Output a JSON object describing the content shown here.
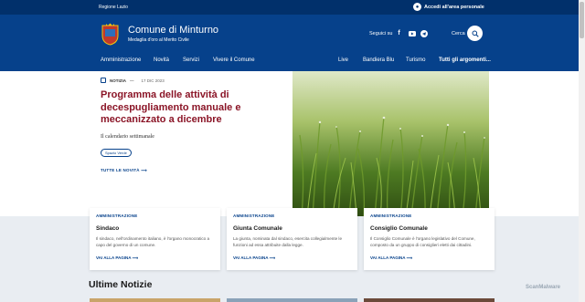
{
  "topbar": {
    "region": "Regione Lazio",
    "access": "Accedi all'area personale"
  },
  "brand": {
    "title": "Comune di Minturno",
    "subtitle": "Medaglia d'oro al Merito Civile"
  },
  "header": {
    "social_label": "Seguici su",
    "search_label": "Cerca"
  },
  "nav": {
    "left": [
      "Amministrazione",
      "Novità",
      "Servizi",
      "Vivere il Comune"
    ],
    "right": [
      "Live",
      "Bandiera Blu",
      "Turismo",
      "Tutti gli argomenti..."
    ]
  },
  "hero": {
    "category": "NOTIZIA",
    "date": "17 DIC 2023",
    "title": "Programma delle attività di decespugliamento manuale e meccanizzato a dicembre",
    "description": "Il calendario settimanale",
    "tag": "Spazio Verde",
    "all_news": "TUTTE LE NOVITÀ"
  },
  "cards": [
    {
      "category": "AMMINISTRAZIONE",
      "title": "Sindaco",
      "desc": "Il sindaco, nell'ordinamento italiano, è l'organo monocratico a capo del governo di un comune.",
      "link": "VAI ALLA PAGINA"
    },
    {
      "category": "AMMINISTRAZIONE",
      "title": "Giunta Comunale",
      "desc": "La giunta, nominata dal sindaco, esercita collegialmente le funzioni ad essa attribuite dalla legge.",
      "link": "VAI ALLA PAGINA"
    },
    {
      "category": "AMMINISTRAZIONE",
      "title": "Consiglio Comunale",
      "desc": "Il Consiglio Comunale è l'organo legislativo del Comune, composto da un gruppo di consiglieri eletti dai cittadini.",
      "link": "VAI ALLA PAGINA"
    }
  ],
  "latest_title": "Ultime Notizie",
  "watermark": "ScanMalware",
  "colors": {
    "primary": "#06418b",
    "dark": "#01306b",
    "accent": "#8b1527"
  },
  "icons": [
    "user-icon",
    "facebook-icon",
    "youtube-icon",
    "telegram-icon",
    "search-icon",
    "calendar-icon",
    "arrow-right-icon",
    "crest-logo"
  ]
}
